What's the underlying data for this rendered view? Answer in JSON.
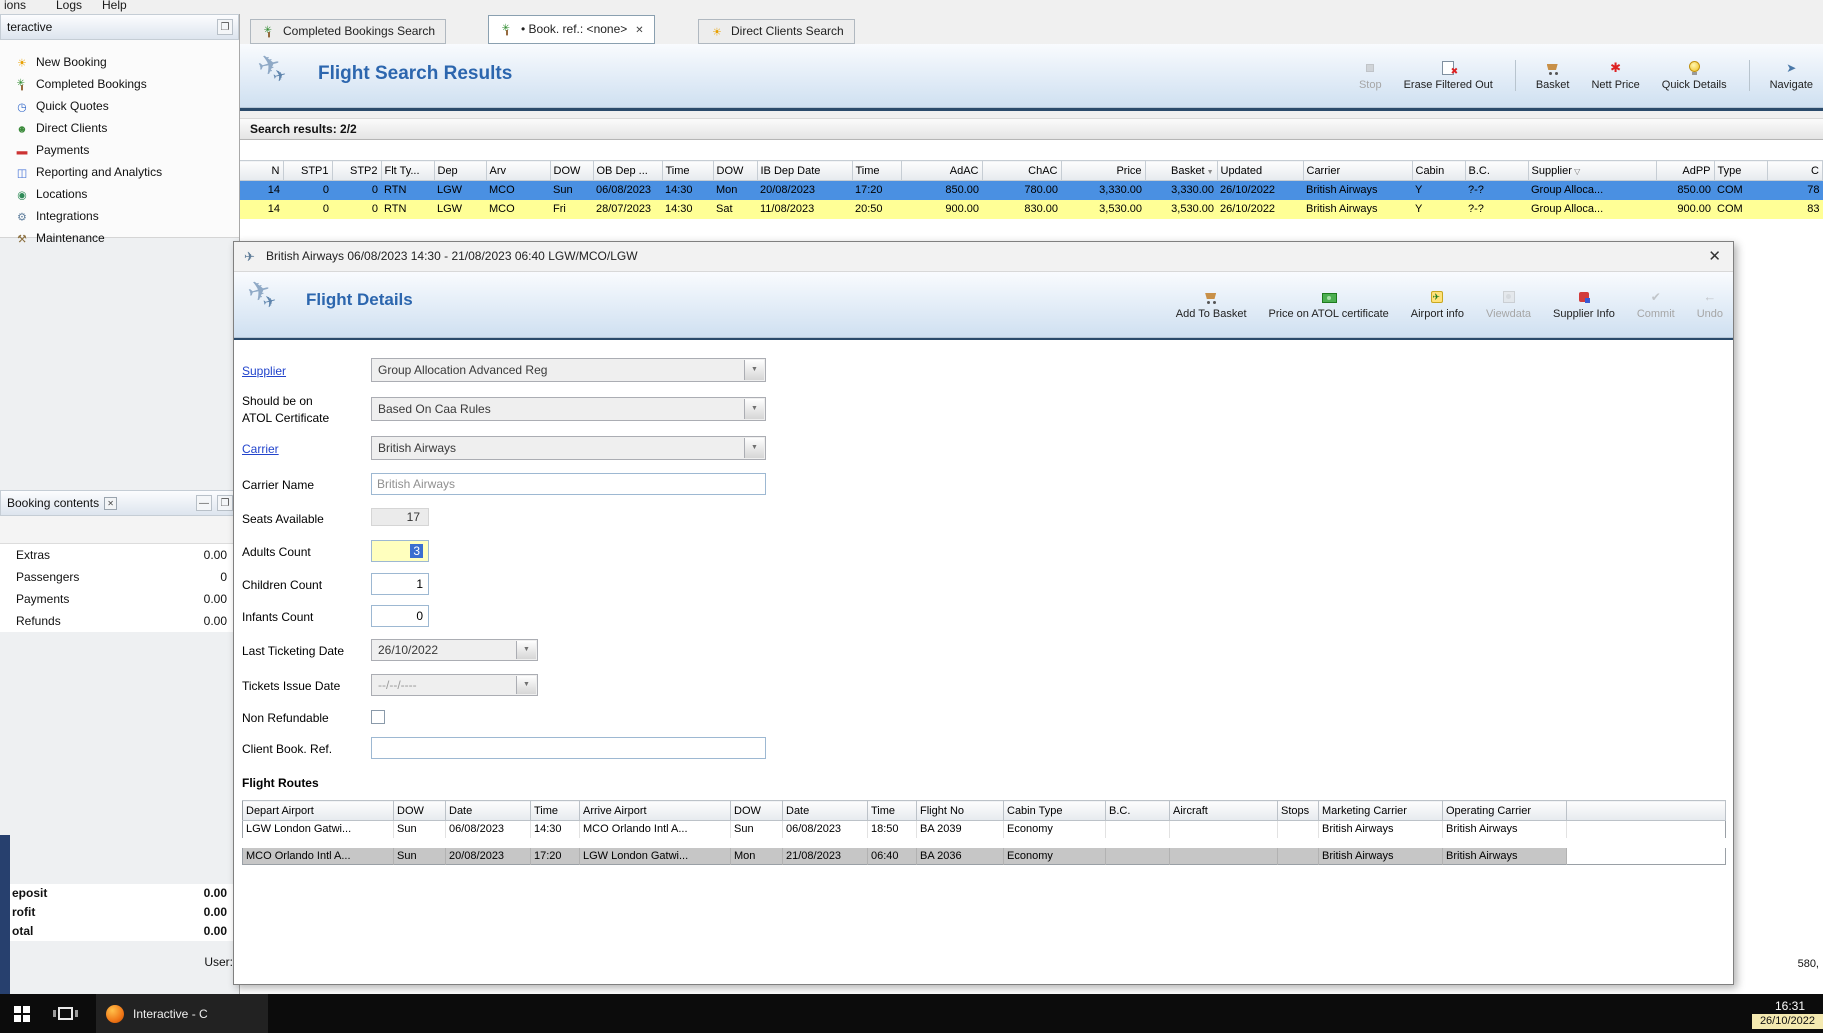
{
  "menubar": {
    "items": [
      "ions",
      "Logs",
      "Help"
    ]
  },
  "sidebar": {
    "title": "teractive",
    "items": [
      {
        "label": "New Booking",
        "icon": "sun-icon"
      },
      {
        "label": "Completed Bookings",
        "icon": "palm-icon"
      },
      {
        "label": "Quick Quotes",
        "icon": "clock-icon"
      },
      {
        "label": "Direct Clients",
        "icon": "clients-icon"
      },
      {
        "label": "Payments",
        "icon": "payments-icon"
      },
      {
        "label": "Reporting and Analytics",
        "icon": "report-icon"
      },
      {
        "label": "Locations",
        "icon": "location-icon"
      },
      {
        "label": "Integrations",
        "icon": "integrations-icon"
      },
      {
        "label": "Maintenance",
        "icon": "maintenance-icon"
      }
    ]
  },
  "booking_contents": {
    "title": "Booking contents",
    "toolbar_icons": [
      {
        "icon": "add-icon"
      },
      {
        "icon": "globe-icon"
      },
      {
        "icon": "basket-add-icon"
      },
      {
        "icon": "delete-icon"
      },
      {
        "icon": "palm-icon"
      },
      {
        "icon": "info-icon"
      }
    ],
    "rows": [
      {
        "label": "Extras",
        "value": "0.00"
      },
      {
        "label": "Passengers",
        "value": "0"
      },
      {
        "label": "Payments",
        "value": "0.00"
      },
      {
        "label": "Refunds",
        "value": "0.00"
      }
    ],
    "totals": [
      {
        "label": "eposit",
        "value": "0.00"
      },
      {
        "label": "rofit",
        "value": "0.00"
      },
      {
        "label": "otal",
        "value": "0.00"
      }
    ],
    "user_label": "User:"
  },
  "tabs": [
    {
      "label": "Completed Bookings Search",
      "icon": "palm-icon"
    },
    {
      "label": "• Book. ref.: <none>",
      "icon": "palm-icon",
      "active": true,
      "closable": true
    },
    {
      "label": "Direct Clients Search",
      "icon": "sun-icon"
    }
  ],
  "results": {
    "title": "Flight Search Results",
    "toolbar": [
      {
        "label": "Stop",
        "icon": "stop-icon",
        "disabled": true
      },
      {
        "label": "Erase Filtered Out",
        "icon": "erase-filter-icon"
      },
      {
        "label": "Basket",
        "icon": "cart-icon"
      },
      {
        "label": "Nett Price",
        "icon": "nett-price-icon"
      },
      {
        "label": "Quick Details",
        "icon": "bulb-icon"
      },
      {
        "label": "Navigate",
        "icon": "navigate-icon"
      }
    ],
    "count_label": "Search results: 2/2",
    "grid": {
      "columns": [
        "N",
        "STP1",
        "STP2",
        "Flt Ty...",
        "Dep",
        "Arv",
        "DOW",
        "OB Dep ...",
        "Time",
        "DOW",
        "IB Dep Date",
        "Time",
        "AdAC",
        "ChAC",
        "Price",
        "Basket",
        "Updated",
        "Carrier",
        "Cabin",
        "B.C.",
        "Supplier",
        "AdPP",
        "Type",
        "C"
      ],
      "rows": [
        [
          "14",
          "0",
          "0",
          "RTN",
          "LGW",
          "MCO",
          "Sun",
          "06/08/2023",
          "14:30",
          "Mon",
          "20/08/2023",
          "17:20",
          "850.00",
          "780.00",
          "3,330.00",
          "3,330.00",
          "26/10/2022",
          "British Airways",
          "Y",
          "?-?",
          "Group Alloca...",
          "850.00",
          "COM",
          "78"
        ],
        [
          "14",
          "0",
          "0",
          "RTN",
          "LGW",
          "MCO",
          "Fri",
          "28/07/2023",
          "14:30",
          "Sat",
          "11/08/2023",
          "20:50",
          "900.00",
          "830.00",
          "3,530.00",
          "3,530.00",
          "26/10/2022",
          "British Airways",
          "Y",
          "?-?",
          "Group Alloca...",
          "900.00",
          "COM",
          "83"
        ]
      ],
      "row_states": [
        "selected",
        "highlight"
      ]
    }
  },
  "dialog": {
    "title": "British Airways 06/08/2023 14:30 - 21/08/2023 06:40 LGW/MCO/LGW",
    "header": "Flight Details",
    "toolbar": [
      {
        "label": "Add To Basket",
        "icon": "cart-icon"
      },
      {
        "label": "Price on ATOL certificate",
        "icon": "atol-icon"
      },
      {
        "label": "Airport info",
        "icon": "airport-info-icon"
      },
      {
        "label": "Viewdata",
        "icon": "viewdata-icon",
        "disabled": true
      },
      {
        "label": "Supplier Info",
        "icon": "supplier-icon"
      },
      {
        "label": "Commit",
        "icon": "commit-icon",
        "disabled": true
      },
      {
        "label": "Undo",
        "icon": "undo-icon",
        "disabled": true
      }
    ],
    "fields": {
      "supplier": {
        "label": "Supplier",
        "value": "Group Allocation Advanced Reg"
      },
      "atol": {
        "label1": "Should be on",
        "label2": "ATOL Certificate",
        "value": "Based On Caa Rules"
      },
      "carrier": {
        "label": "Carrier",
        "value": "British Airways"
      },
      "carrier_name": {
        "label": "Carrier Name",
        "value": "British Airways"
      },
      "seats": {
        "label": "Seats Available",
        "value": "17"
      },
      "adults": {
        "label": "Adults Count",
        "value": "3"
      },
      "children": {
        "label": "Children Count",
        "value": "1"
      },
      "infants": {
        "label": "Infants Count",
        "value": "0"
      },
      "last_ticketing": {
        "label": "Last Ticketing Date",
        "value": "26/10/2022"
      },
      "tickets_issue": {
        "label": "Tickets Issue Date",
        "value": "--/--/----"
      },
      "non_refundable": {
        "label": "Non Refundable"
      },
      "client_ref": {
        "label": "Client Book. Ref.",
        "value": ""
      }
    },
    "routes_title": "Flight Routes",
    "routes": {
      "columns": [
        "Depart Airport",
        "DOW",
        "Date",
        "Time",
        "Arrive Airport",
        "DOW",
        "Date",
        "Time",
        "Flight No",
        "Cabin Type",
        "B.C.",
        "Aircraft",
        "Stops",
        "Marketing Carrier",
        "Operating Carrier"
      ],
      "rows": [
        [
          "LGW London Gatwi...",
          "Sun",
          "06/08/2023",
          "14:30",
          "MCO Orlando Intl A...",
          "Sun",
          "06/08/2023",
          "18:50",
          "BA 2039",
          "Economy",
          "",
          "",
          "",
          "British Airways",
          "British Airways"
        ],
        [
          "MCO Orlando Intl A...",
          "Sun",
          "20/08/2023",
          "17:20",
          "LGW London Gatwi...",
          "Mon",
          "21/08/2023",
          "06:40",
          "BA 2036",
          "Economy",
          "",
          "",
          "",
          "British Airways",
          "British Airways"
        ]
      ],
      "row_states": [
        "plain",
        "gray"
      ]
    }
  },
  "status": {
    "right_value": "580,"
  },
  "taskbar": {
    "app_label": "Interactive - C",
    "time": "16:31",
    "date": "26/10/2022"
  },
  "colors": {
    "accent_blue": "#2c66ae",
    "selected_row": "#4a90e2",
    "highlight_row": "#ffff96",
    "adults_field_bg": "#ffffbe"
  }
}
